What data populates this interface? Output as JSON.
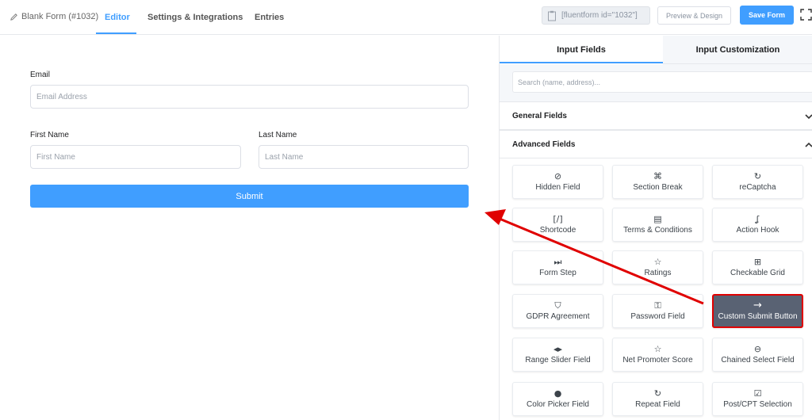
{
  "header": {
    "form_title": "Blank Form (#1032)",
    "tabs": [
      "Editor",
      "Settings & Integrations",
      "Entries"
    ],
    "shortcode": "[fluentform id=\"1032\"]",
    "preview_label": "Preview & Design",
    "save_label": "Save Form"
  },
  "form": {
    "email_label": "Email",
    "email_placeholder": "Email Address",
    "first_name_label": "First Name",
    "first_name_placeholder": "First Name",
    "last_name_label": "Last Name",
    "last_name_placeholder": "Last Name",
    "submit_label": "Submit"
  },
  "sidebar": {
    "tabs": [
      "Input Fields",
      "Input Customization"
    ],
    "search_placeholder": "Search (name, address)...",
    "general_fields": "General Fields",
    "advanced_fields": "Advanced Fields",
    "fields": [
      {
        "label": "Hidden Field",
        "icon": "eye-slash-icon",
        "glyph": "⊘"
      },
      {
        "label": "Section Break",
        "icon": "puzzle-icon",
        "glyph": "⌘"
      },
      {
        "label": "reCaptcha",
        "icon": "recaptcha-icon",
        "glyph": "↻"
      },
      {
        "label": "Shortcode",
        "icon": "shortcode-icon",
        "glyph": "[/]"
      },
      {
        "label": "Terms & Conditions",
        "icon": "document-icon",
        "glyph": "▤"
      },
      {
        "label": "Action Hook",
        "icon": "hook-icon",
        "glyph": "ʆ"
      },
      {
        "label": "Form Step",
        "icon": "step-icon",
        "glyph": "⏭"
      },
      {
        "label": "Ratings",
        "icon": "star-icon",
        "glyph": "☆"
      },
      {
        "label": "Checkable Grid",
        "icon": "grid-icon",
        "glyph": "⊞"
      },
      {
        "label": "GDPR Agreement",
        "icon": "shield-icon",
        "glyph": "⛉"
      },
      {
        "label": "Password Field",
        "icon": "lock-icon",
        "glyph": "⚿"
      },
      {
        "label": "Custom Submit Button",
        "icon": "arrow-right-icon",
        "glyph": "→"
      },
      {
        "label": "Range Slider Field",
        "icon": "range-icon",
        "glyph": "◂▸"
      },
      {
        "label": "Net Promoter Score",
        "icon": "star-icon",
        "glyph": "☆"
      },
      {
        "label": "Chained Select Field",
        "icon": "link-icon",
        "glyph": "⊖"
      },
      {
        "label": "Color Picker Field",
        "icon": "drop-icon",
        "glyph": "●"
      },
      {
        "label": "Repeat Field",
        "icon": "repeat-icon",
        "glyph": "↻"
      },
      {
        "label": "Post/CPT Selection",
        "icon": "select-icon",
        "glyph": "☑"
      }
    ]
  },
  "colors": {
    "accent": "#409eff",
    "highlight_bg": "#596273",
    "annotation_red": "#e00000"
  }
}
